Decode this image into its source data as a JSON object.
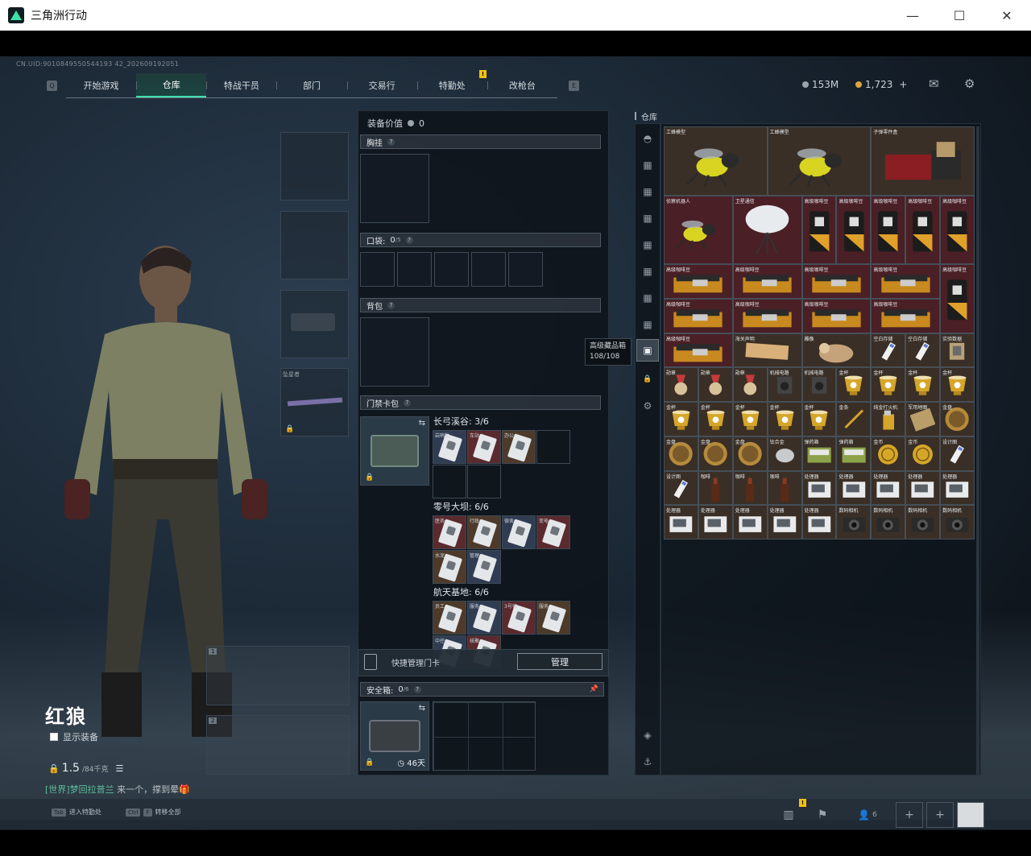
{
  "window": {
    "title": "三角洲行动",
    "minimize": "—",
    "maximize": "☐",
    "close": "✕"
  },
  "header": {
    "uid": "CN.UID:9010849550544193 42_202609192051",
    "keyhint_left": "Q",
    "keyhint_right": "E",
    "tabs": [
      {
        "label": "开始游戏"
      },
      {
        "label": "仓库",
        "active": true
      },
      {
        "label": "特战干员"
      },
      {
        "label": "部门"
      },
      {
        "label": "交易行"
      },
      {
        "label": "特勤处",
        "badge": "!"
      },
      {
        "label": "改枪台"
      }
    ],
    "currency_silver": "153M",
    "currency_gold": "1,723",
    "currency_add": "+",
    "mail_icon": "✉",
    "settings_icon": "⚙"
  },
  "operator": {
    "name": "红狼",
    "show_equipment": "显示装备",
    "weight": "1.5",
    "weight_max": "/84千克",
    "list_icon": "☰",
    "chat_channel": "[世界]",
    "chat_user": "梦回拉普兰",
    "chat_text": "来一个，撑到晕🎁"
  },
  "slots": {
    "melee_label": "坠星者",
    "weapon1_num": "1",
    "weapon2_num": "2"
  },
  "equipment": {
    "value_label": "装备价值",
    "value": "0",
    "chest_rig": "胸挂",
    "pocket_label": "口袋:",
    "pocket_count": "0",
    "pocket_max": "/5",
    "backpack": "背包",
    "keycard_pack": "门禁卡包",
    "maps": [
      {
        "name": "长弓溪谷: 3/6",
        "cards": [
          "岩哨站",
          "车站",
          "办公"
        ]
      },
      {
        "name": "零号大坝: 6/6",
        "cards": [
          "医务",
          "行政",
          "宿舍",
          "变电",
          "水泥",
          "管理"
        ]
      },
      {
        "name": "航天基地: 6/6",
        "cards": [
          "员工",
          "服务",
          "3号宿",
          "服务",
          "中控",
          "核聚"
        ]
      }
    ],
    "quick_manage": "快捷管理门卡",
    "manage_btn": "管理",
    "safebox_label": "安全箱:",
    "safebox_count": "0",
    "safebox_max": "/6",
    "safebox_days": "46天"
  },
  "stash": {
    "title": "仓库",
    "tooltip_title": "高级藏品箱",
    "tooltip_value": "108/108",
    "items": [
      {
        "n": "工蜂模型",
        "k": "bee",
        "c": "#3a2f26",
        "x": 0,
        "y": 0,
        "w": 3,
        "h": 2
      },
      {
        "n": "工蜂模型",
        "k": "bee",
        "c": "#3a2f26",
        "x": 3,
        "y": 0,
        "w": 3,
        "h": 2
      },
      {
        "n": "子弹零件盒",
        "k": "machine",
        "c": "#3a2f26",
        "x": 6,
        "y": 0,
        "w": 3,
        "h": 2
      },
      {
        "n": "侦察机器人",
        "k": "bee",
        "c": "#4a1f25",
        "x": 0,
        "y": 2,
        "w": 2,
        "h": 2
      },
      {
        "n": "卫星通信",
        "k": "dish",
        "c": "#4a1f25",
        "x": 2,
        "y": 2,
        "w": 2,
        "h": 2
      },
      {
        "n": "高级咖啡豆",
        "k": "coffee",
        "c": "#4a1f25",
        "x": 4,
        "y": 2,
        "w": 1,
        "h": 2
      },
      {
        "n": "高级咖啡豆",
        "k": "coffee",
        "c": "#4a1f25",
        "x": 5,
        "y": 2,
        "w": 1,
        "h": 2
      },
      {
        "n": "高级咖啡豆",
        "k": "coffee",
        "c": "#4a1f25",
        "x": 6,
        "y": 2,
        "w": 1,
        "h": 2
      },
      {
        "n": "高级咖啡豆",
        "k": "coffee",
        "c": "#4a1f25",
        "x": 7,
        "y": 2,
        "w": 1,
        "h": 2
      },
      {
        "n": "高级咖啡豆",
        "k": "coffee",
        "c": "#4a1f25",
        "x": 8,
        "y": 2,
        "w": 1,
        "h": 2
      },
      {
        "n": "高级咖啡豆",
        "k": "box",
        "c": "#4a1f25",
        "x": 0,
        "y": 4,
        "w": 2,
        "h": 1
      },
      {
        "n": "高级咖啡豆",
        "k": "box",
        "c": "#4a1f25",
        "x": 2,
        "y": 4,
        "w": 2,
        "h": 1
      },
      {
        "n": "高级咖啡豆",
        "k": "box",
        "c": "#4a1f25",
        "x": 4,
        "y": 4,
        "w": 2,
        "h": 1
      },
      {
        "n": "高级咖啡豆",
        "k": "box",
        "c": "#4a1f25",
        "x": 6,
        "y": 4,
        "w": 2,
        "h": 1
      },
      {
        "n": "高级咖啡豆",
        "k": "coffee",
        "c": "#4a1f25",
        "x": 8,
        "y": 4,
        "w": 1,
        "h": 2
      },
      {
        "n": "高级咖啡豆",
        "k": "box",
        "c": "#4a1f25",
        "x": 0,
        "y": 5,
        "w": 2,
        "h": 1
      },
      {
        "n": "高级咖啡豆",
        "k": "box",
        "c": "#4a1f25",
        "x": 2,
        "y": 5,
        "w": 2,
        "h": 1
      },
      {
        "n": "高级咖啡豆",
        "k": "box",
        "c": "#4a1f25",
        "x": 4,
        "y": 5,
        "w": 2,
        "h": 1
      },
      {
        "n": "高级咖啡豆",
        "k": "box",
        "c": "#4a1f25",
        "x": 6,
        "y": 5,
        "w": 2,
        "h": 1
      },
      {
        "n": "高级咖啡豆",
        "k": "box",
        "c": "#4a1f25",
        "x": 0,
        "y": 6,
        "w": 2,
        "h": 1
      },
      {
        "n": "海关声明",
        "k": "paper",
        "c": "#3a2f26",
        "x": 2,
        "y": 6,
        "w": 2,
        "h": 1
      },
      {
        "n": "雕像",
        "k": "statue",
        "c": "#3a2f26",
        "x": 4,
        "y": 6,
        "w": 2,
        "h": 1
      },
      {
        "n": "空白存储",
        "k": "usb",
        "c": "#3a2f26",
        "x": 6,
        "y": 6,
        "w": 1,
        "h": 1
      },
      {
        "n": "空白存储",
        "k": "usb",
        "c": "#3a2f26",
        "x": 7,
        "y": 6,
        "w": 1,
        "h": 1
      },
      {
        "n": "实验数据",
        "k": "chip",
        "c": "#3a2f26",
        "x": 8,
        "y": 6,
        "w": 1,
        "h": 1
      },
      {
        "n": "勋章",
        "k": "medal",
        "c": "#3a2f26",
        "x": 0,
        "y": 7,
        "w": 1,
        "h": 1
      },
      {
        "n": "勋章",
        "k": "medal",
        "c": "#3a2f26",
        "x": 1,
        "y": 7,
        "w": 1,
        "h": 1
      },
      {
        "n": "勋章",
        "k": "medal",
        "c": "#3a2f26",
        "x": 2,
        "y": 7,
        "w": 1,
        "h": 1
      },
      {
        "n": "机械电路",
        "k": "device",
        "c": "#3a2f26",
        "x": 3,
        "y": 7,
        "w": 1,
        "h": 1
      },
      {
        "n": "机械电路",
        "k": "device",
        "c": "#3a2f26",
        "x": 4,
        "y": 7,
        "w": 1,
        "h": 1
      },
      {
        "n": "金杯",
        "k": "cup",
        "c": "#3a2f26",
        "x": 5,
        "y": 7,
        "w": 1,
        "h": 1
      },
      {
        "n": "金杯",
        "k": "cup",
        "c": "#3a2f26",
        "x": 6,
        "y": 7,
        "w": 1,
        "h": 1
      },
      {
        "n": "金杯",
        "k": "cup",
        "c": "#3a2f26",
        "x": 7,
        "y": 7,
        "w": 1,
        "h": 1
      },
      {
        "n": "金杯",
        "k": "cup",
        "c": "#3a2f26",
        "x": 8,
        "y": 7,
        "w": 1,
        "h": 1
      },
      {
        "n": "金杯",
        "k": "cup",
        "c": "#3a2f26",
        "x": 0,
        "y": 8,
        "w": 1,
        "h": 1
      },
      {
        "n": "金杯",
        "k": "cup",
        "c": "#3a2f26",
        "x": 1,
        "y": 8,
        "w": 1,
        "h": 1
      },
      {
        "n": "金杯",
        "k": "cup",
        "c": "#3a2f26",
        "x": 2,
        "y": 8,
        "w": 1,
        "h": 1
      },
      {
        "n": "金杯",
        "k": "cup",
        "c": "#3a2f26",
        "x": 3,
        "y": 8,
        "w": 1,
        "h": 1
      },
      {
        "n": "金杯",
        "k": "cup",
        "c": "#3a2f26",
        "x": 4,
        "y": 8,
        "w": 1,
        "h": 1
      },
      {
        "n": "金条",
        "k": "knife",
        "c": "#3a2f26",
        "x": 5,
        "y": 8,
        "w": 1,
        "h": 1
      },
      {
        "n": "纯金打火机",
        "k": "lighter",
        "c": "#3a2f26",
        "x": 6,
        "y": 8,
        "w": 1,
        "h": 1
      },
      {
        "n": "军用地图",
        "k": "map",
        "c": "#3a2f26",
        "x": 7,
        "y": 8,
        "w": 1,
        "h": 1
      },
      {
        "n": "金盘",
        "k": "plate",
        "c": "#3a2f26",
        "x": 8,
        "y": 8,
        "w": 1,
        "h": 1
      },
      {
        "n": "金盘",
        "k": "plate",
        "c": "#3a2f26",
        "x": 0,
        "y": 9,
        "w": 1,
        "h": 1
      },
      {
        "n": "金盘",
        "k": "plate",
        "c": "#3a2f26",
        "x": 1,
        "y": 9,
        "w": 1,
        "h": 1
      },
      {
        "n": "金盘",
        "k": "plate",
        "c": "#3a2f26",
        "x": 2,
        "y": 9,
        "w": 1,
        "h": 1
      },
      {
        "n": "钛合金",
        "k": "disk",
        "c": "#3a2f26",
        "x": 3,
        "y": 9,
        "w": 1,
        "h": 1
      },
      {
        "n": "弹药箱",
        "k": "ammo",
        "c": "#3a2f26",
        "x": 4,
        "y": 9,
        "w": 1,
        "h": 1
      },
      {
        "n": "弹药箱",
        "k": "ammo",
        "c": "#3a2f26",
        "x": 5,
        "y": 9,
        "w": 1,
        "h": 1
      },
      {
        "n": "金币",
        "k": "coin",
        "c": "#3a2f26",
        "x": 6,
        "y": 9,
        "w": 1,
        "h": 1
      },
      {
        "n": "金币",
        "k": "coin",
        "c": "#3a2f26",
        "x": 7,
        "y": 9,
        "w": 1,
        "h": 1
      },
      {
        "n": "设计图",
        "k": "usb",
        "c": "#3a2f26",
        "x": 8,
        "y": 9,
        "w": 1,
        "h": 1
      },
      {
        "n": "设计图",
        "k": "usb",
        "c": "#3a2f26",
        "x": 0,
        "y": 10,
        "w": 1,
        "h": 1
      },
      {
        "n": "咖啡",
        "k": "bottle",
        "c": "#3a2f26",
        "x": 1,
        "y": 10,
        "w": 1,
        "h": 1
      },
      {
        "n": "咖啡",
        "k": "bottle",
        "c": "#3a2f26",
        "x": 2,
        "y": 10,
        "w": 1,
        "h": 1
      },
      {
        "n": "咖啡",
        "k": "bottle",
        "c": "#3a2f26",
        "x": 3,
        "y": 10,
        "w": 1,
        "h": 1
      },
      {
        "n": "处理器",
        "k": "gpu",
        "c": "#3a2f26",
        "x": 4,
        "y": 10,
        "w": 1,
        "h": 1
      },
      {
        "n": "处理器",
        "k": "gpu",
        "c": "#3a2f26",
        "x": 5,
        "y": 10,
        "w": 1,
        "h": 1
      },
      {
        "n": "处理器",
        "k": "gpu",
        "c": "#3a2f26",
        "x": 6,
        "y": 10,
        "w": 1,
        "h": 1
      },
      {
        "n": "处理器",
        "k": "gpu",
        "c": "#3a2f26",
        "x": 7,
        "y": 10,
        "w": 1,
        "h": 1
      },
      {
        "n": "处理器",
        "k": "gpu",
        "c": "#3a2f26",
        "x": 8,
        "y": 10,
        "w": 1,
        "h": 1
      },
      {
        "n": "处理器",
        "k": "gpu",
        "c": "#3a2f26",
        "x": 0,
        "y": 11,
        "w": 1,
        "h": 1
      },
      {
        "n": "处理器",
        "k": "gpu",
        "c": "#3a2f26",
        "x": 1,
        "y": 11,
        "w": 1,
        "h": 1
      },
      {
        "n": "处理器",
        "k": "gpu",
        "c": "#3a2f26",
        "x": 2,
        "y": 11,
        "w": 1,
        "h": 1
      },
      {
        "n": "处理器",
        "k": "gpu",
        "c": "#3a2f26",
        "x": 3,
        "y": 11,
        "w": 1,
        "h": 1
      },
      {
        "n": "处理器",
        "k": "gpu",
        "c": "#3a2f26",
        "x": 4,
        "y": 11,
        "w": 1,
        "h": 1
      },
      {
        "n": "数码相机",
        "k": "camera",
        "c": "#3a2f26",
        "x": 5,
        "y": 11,
        "w": 1,
        "h": 1
      },
      {
        "n": "数码相机",
        "k": "camera",
        "c": "#3a2f26",
        "x": 6,
        "y": 11,
        "w": 1,
        "h": 1
      },
      {
        "n": "数码相机",
        "k": "camera",
        "c": "#3a2f26",
        "x": 7,
        "y": 11,
        "w": 1,
        "h": 1
      },
      {
        "n": "数码相机",
        "k": "camera",
        "c": "#3a2f26",
        "x": 8,
        "y": 11,
        "w": 1,
        "h": 1
      }
    ]
  },
  "bottom": {
    "hint1_key": "Tab",
    "hint1": "进入特勤处",
    "hint2_key1": "Ctrl",
    "hint2_key2": "F",
    "hint2": "转移全部",
    "team_count": "6",
    "badge": "!"
  }
}
